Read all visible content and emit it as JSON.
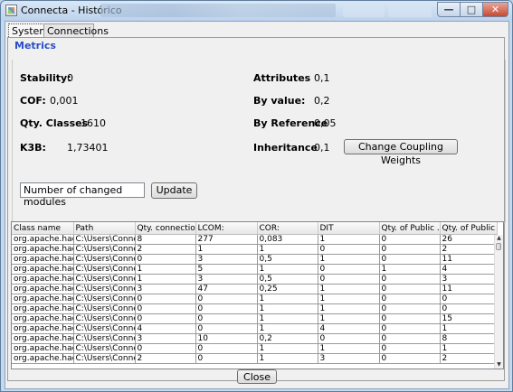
{
  "window": {
    "title": "Connecta - Histórico"
  },
  "tabs": [
    {
      "label": "System"
    },
    {
      "label": "Connections"
    }
  ],
  "metrics": {
    "group_title": "Metrics",
    "left": [
      {
        "label": "Stability:",
        "value": "0"
      },
      {
        "label": "COF:",
        "value": "0,001"
      },
      {
        "label": "Qty. Classes",
        "value": "1610"
      },
      {
        "label": "K3B:",
        "value": "1,73401"
      }
    ],
    "right": [
      {
        "label": "Attributes",
        "value": "0,1"
      },
      {
        "label": "By value:",
        "value": "0,2"
      },
      {
        "label": "By Reference",
        "value": "0,05"
      },
      {
        "label": "Inheritance",
        "value": "0,1"
      }
    ],
    "change_weights_label": "Change Coupling Weights"
  },
  "changed_modules": {
    "value": "Number of changed modules",
    "update_label": "Update"
  },
  "table": {
    "columns": [
      "Class name",
      "Path",
      "Qty. connections",
      "LCOM:",
      "COR:",
      "DIT",
      "Qty. of Public ...",
      "Qty. of Public ..."
    ],
    "rows": [
      [
        "org.apache.had...",
        "C:\\Users\\Conne...",
        "8",
        "277",
        "0,083",
        "1",
        "0",
        "26"
      ],
      [
        "org.apache.had...",
        "C:\\Users\\Conne...",
        "2",
        "1",
        "1",
        "0",
        "0",
        "2"
      ],
      [
        "org.apache.had...",
        "C:\\Users\\Conne...",
        "0",
        "3",
        "0,5",
        "1",
        "0",
        "11"
      ],
      [
        "org.apache.had...",
        "C:\\Users\\Conne...",
        "1",
        "5",
        "1",
        "0",
        "1",
        "4"
      ],
      [
        "org.apache.had...",
        "C:\\Users\\Conne...",
        "1",
        "3",
        "0,5",
        "0",
        "0",
        "3"
      ],
      [
        "org.apache.had...",
        "C:\\Users\\Conne...",
        "3",
        "47",
        "0,25",
        "1",
        "0",
        "11"
      ],
      [
        "org.apache.had...",
        "C:\\Users\\Conne...",
        "0",
        "0",
        "1",
        "1",
        "0",
        "0"
      ],
      [
        "org.apache.had...",
        "C:\\Users\\Conne...",
        "0",
        "0",
        "1",
        "1",
        "0",
        "0"
      ],
      [
        "org.apache.had...",
        "C:\\Users\\Conne...",
        "0",
        "0",
        "1",
        "1",
        "0",
        "15"
      ],
      [
        "org.apache.had...",
        "C:\\Users\\Conne...",
        "4",
        "0",
        "1",
        "4",
        "0",
        "1"
      ],
      [
        "org.apache.had...",
        "C:\\Users\\Conne...",
        "3",
        "10",
        "0,2",
        "0",
        "0",
        "8"
      ],
      [
        "org.apache.had...",
        "C:\\Users\\Conne...",
        "0",
        "0",
        "1",
        "1",
        "0",
        "1"
      ],
      [
        "org.apache.had...",
        "C:\\Users\\Conne...",
        "2",
        "0",
        "1",
        "3",
        "0",
        "2"
      ]
    ]
  },
  "footer": {
    "close_label": "Close"
  },
  "colors": {
    "group_title": "#2a4cc6",
    "title_bar": "#c4d8ee",
    "close_button": "#c54a33"
  }
}
